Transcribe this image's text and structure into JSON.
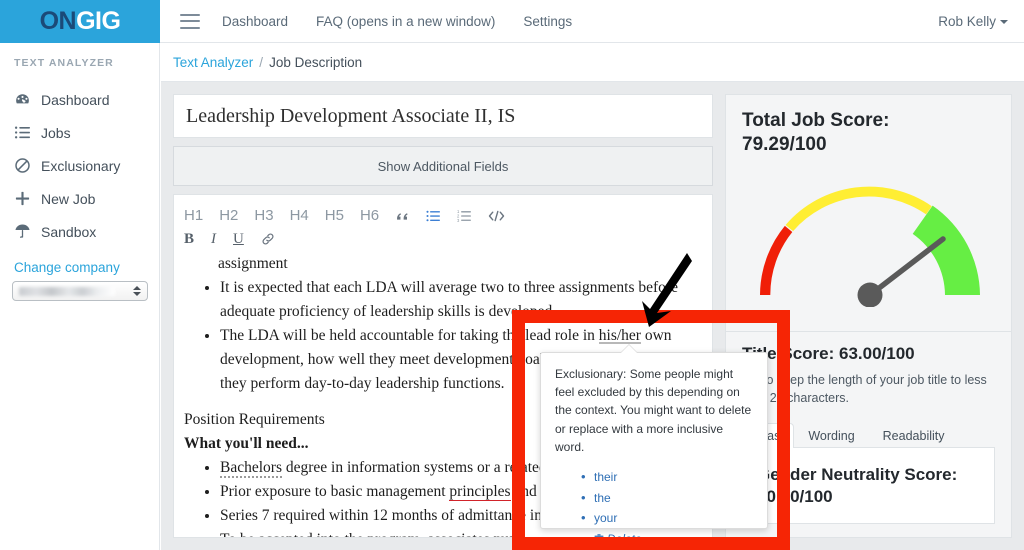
{
  "brand": {
    "logo_part1": "ON",
    "logo_part2": "GIG",
    "logo_bg": "#2ba4db",
    "accent": "#2ba4db"
  },
  "topnav": {
    "menu_icon": "hamburger-icon",
    "links": [
      {
        "label": "Dashboard"
      },
      {
        "label": "FAQ (opens in a new window)"
      },
      {
        "label": "Settings"
      }
    ],
    "user": "Rob Kelly"
  },
  "sidebar": {
    "heading": "TEXT ANALYZER",
    "items": [
      {
        "label": "Dashboard",
        "icon": "dashboard-gauge-icon"
      },
      {
        "label": "Jobs",
        "icon": "list-icon"
      },
      {
        "label": "Exclusionary",
        "icon": "ban-circle-icon"
      },
      {
        "label": "New Job",
        "icon": "plus-icon"
      },
      {
        "label": "Sandbox",
        "icon": "beach-umbrella-icon"
      }
    ],
    "change_company": "Change company",
    "company_value": ""
  },
  "breadcrumb": {
    "root": "Text Analyzer",
    "separator": "/",
    "current": "Job Description"
  },
  "editor": {
    "job_title": "Leadership Development Associate II, IS",
    "show_fields_label": "Show Additional Fields",
    "toolbar_headings": [
      "H1",
      "H2",
      "H3",
      "H4",
      "H5",
      "H6"
    ],
    "toolbar_icons": [
      {
        "name": "blockquote-icon",
        "glyph": "”",
        "active": false
      },
      {
        "name": "unordered-list-icon",
        "glyph": "",
        "active": true
      },
      {
        "name": "ordered-list-icon",
        "glyph": "",
        "active": false
      },
      {
        "name": "code-icon",
        "glyph": "</>",
        "active": false
      }
    ],
    "toolbar_format": [
      {
        "name": "bold-icon",
        "label": "B"
      },
      {
        "name": "italic-icon",
        "label": "I"
      },
      {
        "name": "underline-icon",
        "label": "U"
      },
      {
        "name": "link-icon",
        "label": "🔗"
      }
    ],
    "body": {
      "lead_fragment": "assignment",
      "bullets_top": [
        "It is expected that each LDA will average two to three assignments before adequate proficiency of leadership skills is developed.",
        "The LDA will be held accountable for taking the lead role in his/her own development, how well they meet development goals, as well as how well they perform day-to-day leadership functions."
      ],
      "bullet2_pre": "The LDA will be held accountable for taking the lead role in ",
      "bullet2_flagged": "his/her",
      "bullet2_post": " own development, how well they meet development goals, as well as how well they perform day-to-day leadership functions.",
      "section_heading": "Position Requirements",
      "subheading": "What you'll need...",
      "req_bullets": [
        {
          "pre": "",
          "flagged_dotted": "Bachelors",
          "mid": " degree in information systems or a related field",
          "flagged_red": "",
          "post": ""
        },
        {
          "pre": "Prior exposure to basic management ",
          "flagged_dotted": "",
          "mid": "",
          "flagged_red": "principles",
          "post": " and practices"
        },
        {
          "pre": "Series 7 required within 12 months of admittance into the program",
          "flagged_dotted": "",
          "mid": "",
          "flagged_red": "",
          "post": ""
        },
        {
          "pre": "To be accepted into the program, associates must",
          "flagged_dotted": "",
          "mid": "",
          "flagged_red": "",
          "post": ""
        }
      ]
    }
  },
  "tooltip": {
    "text": "Exclusionary: Some people might feel excluded by this depending on the context. You might want to delete or replace with a more inclusive word.",
    "suggestions": [
      "their",
      "the",
      "your"
    ],
    "delete_label": "Delete",
    "delete_icon": "trash-icon",
    "link_color": "#2f6fb5"
  },
  "scores": {
    "total_label": "Total Job Score:",
    "total_value": "79.29/100",
    "title_score_label": "Title Score: 63.00/100",
    "title_score_hint": "Try to keep the length of your job title to less than 20 characters.",
    "tabs": [
      {
        "label": "Bias",
        "active": true
      },
      {
        "label": "Wording",
        "active": false
      },
      {
        "label": "Readability",
        "active": false
      }
    ],
    "gender_label": "Gender Neutrality Score:",
    "gender_value": "80.70/100"
  },
  "chart_data": {
    "type": "gauge",
    "title": "Total Job Score:",
    "value": 79.29,
    "display_value": "79.29/100",
    "min": 0,
    "max": 100,
    "needle_value": 79.29,
    "bands": [
      {
        "name": "low",
        "from": 0,
        "to": 22,
        "color": "#f01f08",
        "thickness": 9
      },
      {
        "name": "medium",
        "from": 22,
        "to": 69,
        "color": "#ffee33",
        "thickness": 9
      },
      {
        "name": "high",
        "from": 69,
        "to": 100,
        "color": "#66ee44",
        "thickness": 34
      }
    ],
    "start_angle": 180,
    "end_angle": 0,
    "needle_color": "#5a5a5a",
    "hub_color": "#5a5a5a"
  },
  "annotations": {
    "highlight_rect_color": "#f62505",
    "arrow_color": "#000000"
  }
}
